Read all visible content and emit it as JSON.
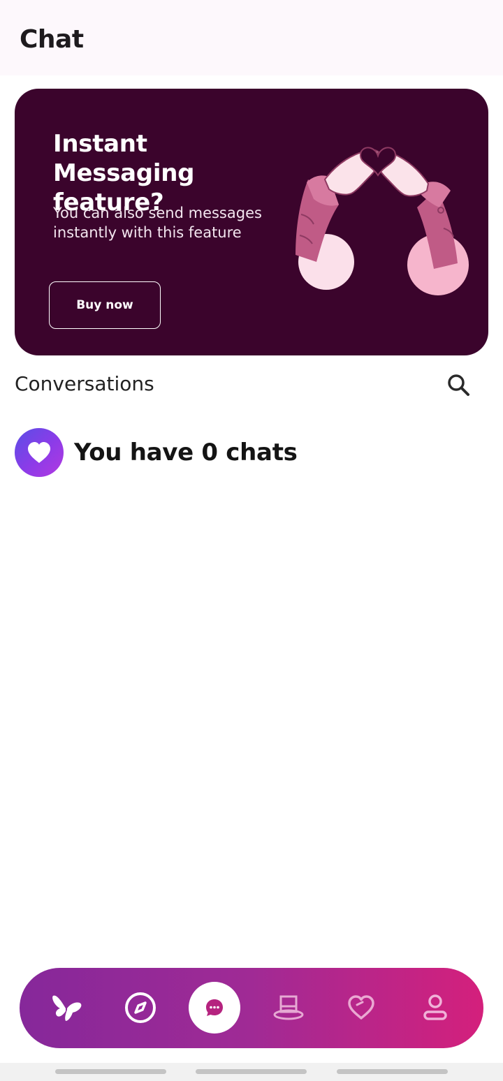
{
  "header": {
    "title": "Chat"
  },
  "promo": {
    "title": "Instant Messaging feature?",
    "description": "You can also send messages instantly with this feature",
    "button_label": "Buy now",
    "illustration_icon": "heart-hands-illustration",
    "background_color": "#3b042c"
  },
  "conversations": {
    "title": "Conversations",
    "search_icon": "search-icon",
    "empty_text": "You have 0 chats",
    "empty_icon": "heart-icon"
  },
  "bottom_nav": {
    "items": [
      {
        "icon": "butterfly-icon",
        "active": false
      },
      {
        "icon": "compass-icon",
        "active": false
      },
      {
        "icon": "chat-bubble-icon",
        "active": true
      },
      {
        "icon": "top-hat-icon",
        "active": false
      },
      {
        "icon": "heart-outline-icon",
        "active": false
      },
      {
        "icon": "profile-icon",
        "active": false
      }
    ],
    "gradient_start": "#86289a",
    "gradient_end": "#d4207c"
  }
}
